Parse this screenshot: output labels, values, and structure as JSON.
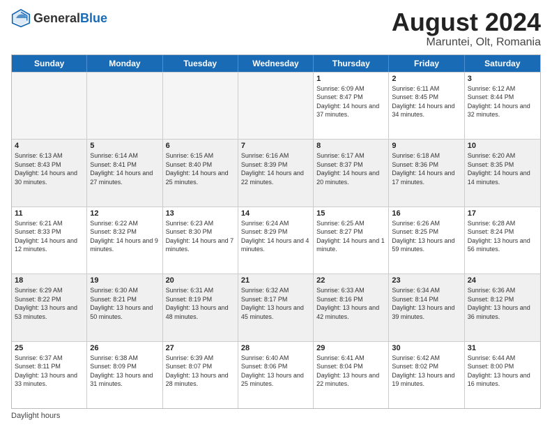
{
  "header": {
    "logo_general": "General",
    "logo_blue": "Blue",
    "title": "August 2024",
    "location": "Maruntei, Olt, Romania"
  },
  "days_of_week": [
    "Sunday",
    "Monday",
    "Tuesday",
    "Wednesday",
    "Thursday",
    "Friday",
    "Saturday"
  ],
  "weeks": [
    [
      {
        "day": "",
        "sunrise": "",
        "sunset": "",
        "daylight": "",
        "empty": true
      },
      {
        "day": "",
        "sunrise": "",
        "sunset": "",
        "daylight": "",
        "empty": true
      },
      {
        "day": "",
        "sunrise": "",
        "sunset": "",
        "daylight": "",
        "empty": true
      },
      {
        "day": "",
        "sunrise": "",
        "sunset": "",
        "daylight": "",
        "empty": true
      },
      {
        "day": "1",
        "sunrise": "Sunrise: 6:09 AM",
        "sunset": "Sunset: 8:47 PM",
        "daylight": "Daylight: 14 hours and 37 minutes."
      },
      {
        "day": "2",
        "sunrise": "Sunrise: 6:11 AM",
        "sunset": "Sunset: 8:45 PM",
        "daylight": "Daylight: 14 hours and 34 minutes."
      },
      {
        "day": "3",
        "sunrise": "Sunrise: 6:12 AM",
        "sunset": "Sunset: 8:44 PM",
        "daylight": "Daylight: 14 hours and 32 minutes."
      }
    ],
    [
      {
        "day": "4",
        "sunrise": "Sunrise: 6:13 AM",
        "sunset": "Sunset: 8:43 PM",
        "daylight": "Daylight: 14 hours and 30 minutes."
      },
      {
        "day": "5",
        "sunrise": "Sunrise: 6:14 AM",
        "sunset": "Sunset: 8:41 PM",
        "daylight": "Daylight: 14 hours and 27 minutes."
      },
      {
        "day": "6",
        "sunrise": "Sunrise: 6:15 AM",
        "sunset": "Sunset: 8:40 PM",
        "daylight": "Daylight: 14 hours and 25 minutes."
      },
      {
        "day": "7",
        "sunrise": "Sunrise: 6:16 AM",
        "sunset": "Sunset: 8:39 PM",
        "daylight": "Daylight: 14 hours and 22 minutes."
      },
      {
        "day": "8",
        "sunrise": "Sunrise: 6:17 AM",
        "sunset": "Sunset: 8:37 PM",
        "daylight": "Daylight: 14 hours and 20 minutes."
      },
      {
        "day": "9",
        "sunrise": "Sunrise: 6:18 AM",
        "sunset": "Sunset: 8:36 PM",
        "daylight": "Daylight: 14 hours and 17 minutes."
      },
      {
        "day": "10",
        "sunrise": "Sunrise: 6:20 AM",
        "sunset": "Sunset: 8:35 PM",
        "daylight": "Daylight: 14 hours and 14 minutes."
      }
    ],
    [
      {
        "day": "11",
        "sunrise": "Sunrise: 6:21 AM",
        "sunset": "Sunset: 8:33 PM",
        "daylight": "Daylight: 14 hours and 12 minutes."
      },
      {
        "day": "12",
        "sunrise": "Sunrise: 6:22 AM",
        "sunset": "Sunset: 8:32 PM",
        "daylight": "Daylight: 14 hours and 9 minutes."
      },
      {
        "day": "13",
        "sunrise": "Sunrise: 6:23 AM",
        "sunset": "Sunset: 8:30 PM",
        "daylight": "Daylight: 14 hours and 7 minutes."
      },
      {
        "day": "14",
        "sunrise": "Sunrise: 6:24 AM",
        "sunset": "Sunset: 8:29 PM",
        "daylight": "Daylight: 14 hours and 4 minutes."
      },
      {
        "day": "15",
        "sunrise": "Sunrise: 6:25 AM",
        "sunset": "Sunset: 8:27 PM",
        "daylight": "Daylight: 14 hours and 1 minute."
      },
      {
        "day": "16",
        "sunrise": "Sunrise: 6:26 AM",
        "sunset": "Sunset: 8:25 PM",
        "daylight": "Daylight: 13 hours and 59 minutes."
      },
      {
        "day": "17",
        "sunrise": "Sunrise: 6:28 AM",
        "sunset": "Sunset: 8:24 PM",
        "daylight": "Daylight: 13 hours and 56 minutes."
      }
    ],
    [
      {
        "day": "18",
        "sunrise": "Sunrise: 6:29 AM",
        "sunset": "Sunset: 8:22 PM",
        "daylight": "Daylight: 13 hours and 53 minutes."
      },
      {
        "day": "19",
        "sunrise": "Sunrise: 6:30 AM",
        "sunset": "Sunset: 8:21 PM",
        "daylight": "Daylight: 13 hours and 50 minutes."
      },
      {
        "day": "20",
        "sunrise": "Sunrise: 6:31 AM",
        "sunset": "Sunset: 8:19 PM",
        "daylight": "Daylight: 13 hours and 48 minutes."
      },
      {
        "day": "21",
        "sunrise": "Sunrise: 6:32 AM",
        "sunset": "Sunset: 8:17 PM",
        "daylight": "Daylight: 13 hours and 45 minutes."
      },
      {
        "day": "22",
        "sunrise": "Sunrise: 6:33 AM",
        "sunset": "Sunset: 8:16 PM",
        "daylight": "Daylight: 13 hours and 42 minutes."
      },
      {
        "day": "23",
        "sunrise": "Sunrise: 6:34 AM",
        "sunset": "Sunset: 8:14 PM",
        "daylight": "Daylight: 13 hours and 39 minutes."
      },
      {
        "day": "24",
        "sunrise": "Sunrise: 6:36 AM",
        "sunset": "Sunset: 8:12 PM",
        "daylight": "Daylight: 13 hours and 36 minutes."
      }
    ],
    [
      {
        "day": "25",
        "sunrise": "Sunrise: 6:37 AM",
        "sunset": "Sunset: 8:11 PM",
        "daylight": "Daylight: 13 hours and 33 minutes."
      },
      {
        "day": "26",
        "sunrise": "Sunrise: 6:38 AM",
        "sunset": "Sunset: 8:09 PM",
        "daylight": "Daylight: 13 hours and 31 minutes."
      },
      {
        "day": "27",
        "sunrise": "Sunrise: 6:39 AM",
        "sunset": "Sunset: 8:07 PM",
        "daylight": "Daylight: 13 hours and 28 minutes."
      },
      {
        "day": "28",
        "sunrise": "Sunrise: 6:40 AM",
        "sunset": "Sunset: 8:06 PM",
        "daylight": "Daylight: 13 hours and 25 minutes."
      },
      {
        "day": "29",
        "sunrise": "Sunrise: 6:41 AM",
        "sunset": "Sunset: 8:04 PM",
        "daylight": "Daylight: 13 hours and 22 minutes."
      },
      {
        "day": "30",
        "sunrise": "Sunrise: 6:42 AM",
        "sunset": "Sunset: 8:02 PM",
        "daylight": "Daylight: 13 hours and 19 minutes."
      },
      {
        "day": "31",
        "sunrise": "Sunrise: 6:44 AM",
        "sunset": "Sunset: 8:00 PM",
        "daylight": "Daylight: 13 hours and 16 minutes."
      }
    ]
  ],
  "footer": {
    "note": "Daylight hours"
  }
}
